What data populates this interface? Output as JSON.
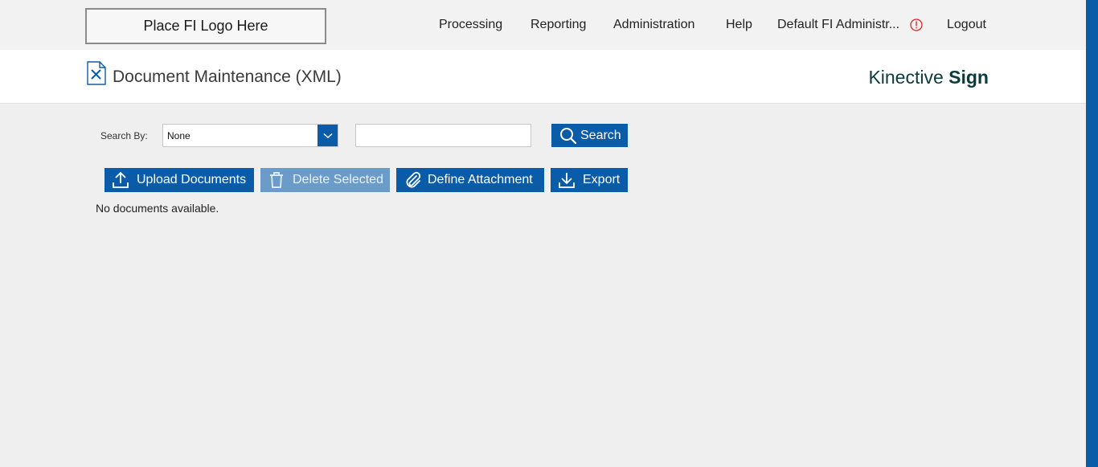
{
  "logo": {
    "text": "Place FI Logo Here"
  },
  "nav": {
    "processing": "Processing",
    "reporting": "Reporting",
    "administration": "Administration",
    "help": "Help",
    "user": "Default FI Administr...",
    "logout": "Logout"
  },
  "header": {
    "title": "Document Maintenance (XML)",
    "brand_light": "Kinective ",
    "brand_bold": "Sign"
  },
  "search": {
    "label": "Search By:",
    "select_value": "None",
    "input_value": "",
    "button_label": "Search"
  },
  "toolbar": {
    "upload_label": "Upload Documents",
    "delete_label": "Delete Selected",
    "attachment_label": "Define Attachment",
    "export_label": "Export"
  },
  "content": {
    "empty_message": "No documents available."
  },
  "colors": {
    "primary": "#0b5ca8",
    "disabled": "#6b9cc9",
    "alert": "#e02424",
    "brand": "#0b3b3c"
  }
}
